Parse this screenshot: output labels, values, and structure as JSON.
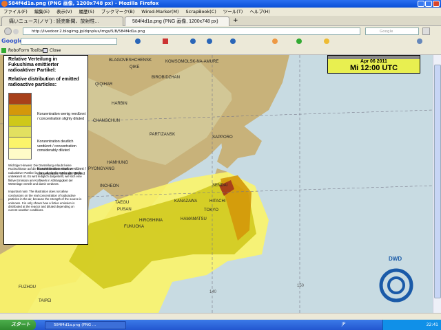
{
  "window": {
    "title": "584f4d1a.png (PNG 画像, 1200x748 px) - Mozilla Firefox"
  },
  "menu": [
    "ファイル(F)",
    "編集(E)",
    "表示(V)",
    "履歴(S)",
    "ブックマーク(B)",
    "Wired-Marker(M)",
    "ScrapBook(C)",
    "ツール(T)",
    "ヘルプ(H)"
  ],
  "tabs": [
    {
      "label": "痛いニュース(ノ∀`) : 読売新聞、放射性..."
    },
    {
      "label": "584f4d1a.png (PNG 画像, 1200x748 px)"
    }
  ],
  "nav": {
    "url": "http://livedoor.2.blogimg.jp/dqnplus/imgs/5/8/584f4d1a.png",
    "search_placeholder": "Google"
  },
  "googlebar": {
    "brand": "Google"
  },
  "robobar": {
    "toolbar": "RoboForm Toolbar",
    "close": "Close"
  },
  "legend": {
    "title_de": "Relative Verteilung in Fukushima emittierter radioaktiver Partikel:",
    "title_en": "Relative distribution of emitted radioactive particles:",
    "colors": [
      "#a8401a",
      "#d4980a",
      "#cfc81a",
      "#e2e060",
      "#fbf46a",
      "#fffbc8"
    ],
    "entries": [
      {
        "text": "Konzentration wenig verdünnt / concentration slighly diluted"
      },
      {
        "text": "Konzentration deutlich verdünnt / concentration considerably diluted"
      },
      {
        "text": "Konzentration stark verdünnt / concentration strongly diluted"
      }
    ],
    "note_de": "Wichtiger Hinweis: Die Darstellung erlaubt keine Rückschlüsse auf die tatsächliche Konzentration radioaktiver Partikel in der Luft, da die Stärke der Quelle unbekannt ist. Es wird lediglich dargestellt, wie sich eine fiktive Emission am Kraftwerk in Abhängigkeit der Wetterlage verteilt und damit verdünnt.",
    "note_en": "Important note: The illustration does not allow conclusions on the real concentration of radioactive particles in the air, because the strength of the source is unknown. It is only shown how a fictive emission is distributed at the reactor and diluted depending on current weather conditions."
  },
  "datebox": {
    "date": "Apr 06 2011",
    "time": "Mi 12:00 UTC"
  },
  "map": {
    "cities": [
      "BLAGOVESHCHENSK",
      "QIKE",
      "KOMSOMOLSK-NA-AMURE",
      "BIROBIDZHAN",
      "QIQIHAR",
      "HARBIN",
      "CHANGCHUN",
      "PARTIZANSK",
      "SAPPORO",
      "HAMHUNG",
      "PYONGYANG",
      "INCHEON",
      "TAEGU",
      "PUSAN",
      "SENDAI",
      "KANAZAWA",
      "HITACHI",
      "TOKYO",
      "HIROSHIMA",
      "HAMAMATSU",
      "FUKUOKA",
      "FUZHOU",
      "TAIPEI"
    ],
    "longitudes": [
      "140",
      "150"
    ],
    "logo": "DWD",
    "colors": {
      "sea": "#c8dbe2",
      "land": "#c8b27a"
    }
  },
  "taskbar": {
    "start": "スタート",
    "task": "584f4d1a.png (PNG ...",
    "ime": "JP",
    "clock": "22:41"
  }
}
